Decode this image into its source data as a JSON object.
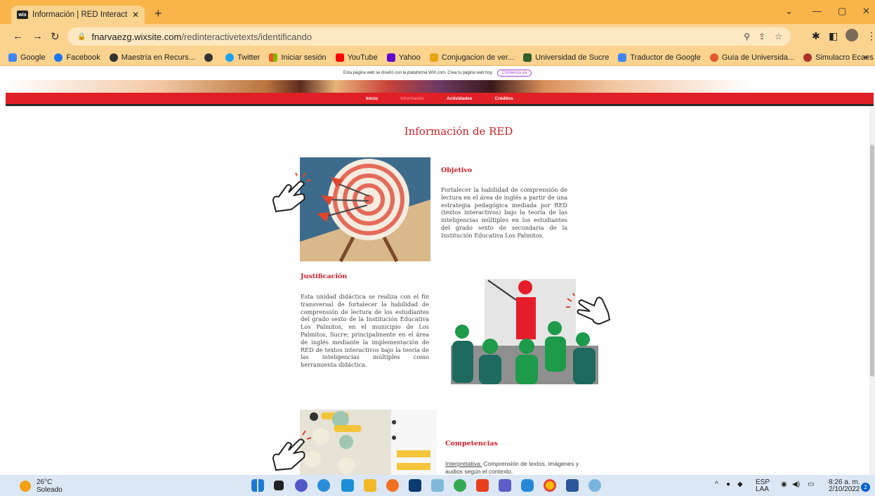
{
  "browser": {
    "tab_title": "Información | RED InteractiveText",
    "tab_favicon": "wix",
    "new_tab": "+",
    "url_domain": "fnarvaezg.wixsite.com",
    "url_path": "/redinteractivetexts/identificando"
  },
  "bookmarks": [
    {
      "label": "Google",
      "color": "#4285f4"
    },
    {
      "label": "Facebook",
      "color": "#1877f2"
    },
    {
      "label": "Maestría en Recurs...",
      "color": "#333333"
    },
    {
      "label": "",
      "color": "#333333"
    },
    {
      "label": "Twitter",
      "color": "#1da1f2"
    },
    {
      "label": "Iniciar sesión",
      "color": "#f25022"
    },
    {
      "label": "YouTube",
      "color": "#ff0000"
    },
    {
      "label": "Yahoo",
      "color": "#6001d2"
    },
    {
      "label": "Conjugacion de ver...",
      "color": "#e8a317"
    },
    {
      "label": "Universidad de Sucre",
      "color": "#2d5f2d"
    },
    {
      "label": "Traductor de Google",
      "color": "#4285f4"
    },
    {
      "label": "Guía de Universida...",
      "color": "#e05a2b"
    },
    {
      "label": "Simulacro Ecaes -...",
      "color": "#b0302a"
    }
  ],
  "bookmarks_more": "»",
  "wix_banner": {
    "text": "Esta página web se diseñó con la plataforma WiX.com. Crea tu página web hoy.",
    "button": "Comienza ya"
  },
  "site_nav": [
    "Inicio",
    "Información",
    "Actividades",
    "Créditos"
  ],
  "page": {
    "title": "Información de RED",
    "objetivo_heading": "Objetivo",
    "objetivo_text": "Fortalecer la habilidad de comprensión de lectura en el área de inglés a partir de una estrategia pedagógica mediada por RED (textos interactivos) bajo la teoría de las inteligencias múltiples en los estudiantes del grado sexto de secundaria de la Institución Educativa Los Palmitos.",
    "justificacion_heading": "Justificación",
    "justificacion_text": "Esta unidad didáctica se realiza con el fin transversal de fortalecer la habilidad de comprensión de lectura de los estudiantes del grado sexto de la Institución Educativa Los Palmitos, en el municipio de Los Palmitos, Sucre; principalmente en el área de inglés mediante la implementación de RED de textos interactivos bajo la teoría de las inteligencias múltiples como herramienta didáctica.",
    "competencias_heading": "Competencias",
    "competencias_label": "Interpretativa:",
    "competencias_text": " Comprensión de textos, imágenes y audios según el contexto."
  },
  "taskbar": {
    "temperature": "26°C",
    "weather": "Soleado",
    "lang_top": "ESP",
    "lang_bottom": "LAA",
    "time": "8:26 a. m.",
    "date": "2/10/2022",
    "notifications": "2"
  },
  "colors": {
    "accent_red": "#d21f26",
    "chrome_orange": "#f9b44a"
  }
}
